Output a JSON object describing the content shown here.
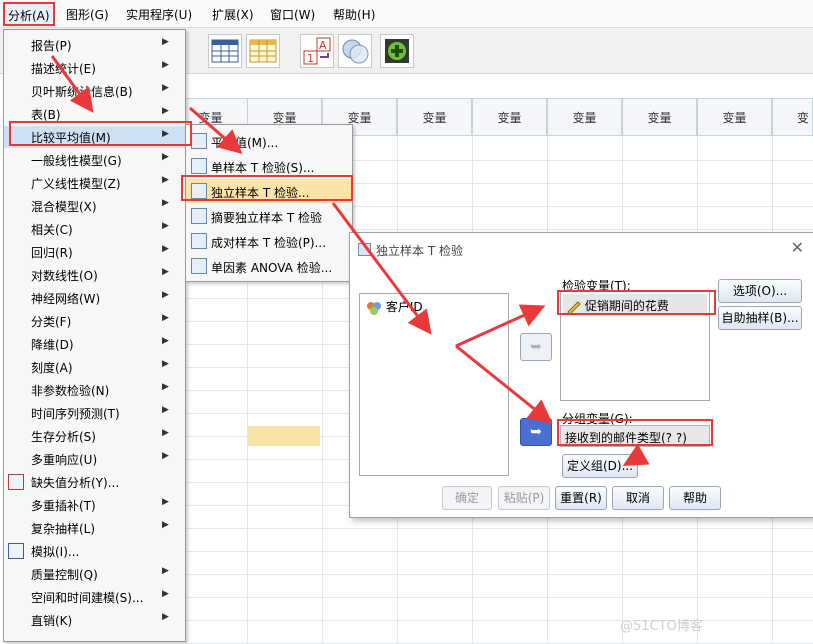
{
  "menubar": {
    "items": [
      "分析(A)",
      "图形(G)",
      "实用程序(U)",
      "扩展(X)",
      "窗口(W)",
      "帮助(H)"
    ]
  },
  "grid": {
    "column_header": "变量",
    "column_header_partial": "变"
  },
  "analyze_menu": {
    "items": [
      {
        "label": "报告(P)"
      },
      {
        "label": "描述统计(E)"
      },
      {
        "label": "贝叶斯统计信息(B)"
      },
      {
        "label": "表(B)"
      },
      {
        "label": "比较平均值(M)"
      },
      {
        "label": "一般线性模型(G)"
      },
      {
        "label": "广义线性模型(Z)"
      },
      {
        "label": "混合模型(X)"
      },
      {
        "label": "相关(C)"
      },
      {
        "label": "回归(R)"
      },
      {
        "label": "对数线性(O)"
      },
      {
        "label": "神经网络(W)"
      },
      {
        "label": "分类(F)"
      },
      {
        "label": "降维(D)"
      },
      {
        "label": "刻度(A)"
      },
      {
        "label": "非参数检验(N)"
      },
      {
        "label": "时间序列预测(T)"
      },
      {
        "label": "生存分析(S)"
      },
      {
        "label": "多重响应(U)"
      },
      {
        "label": "缺失值分析(Y)..."
      },
      {
        "label": "多重插补(T)"
      },
      {
        "label": "复杂抽样(L)"
      },
      {
        "label": "模拟(I)..."
      },
      {
        "label": "质量控制(Q)"
      },
      {
        "label": "空间和时间建模(S)..."
      },
      {
        "label": "直销(K)"
      }
    ]
  },
  "compare_means_menu": {
    "items": [
      {
        "label": "平均值(M)..."
      },
      {
        "label": "单样本 T 检验(S)..."
      },
      {
        "label": "独立样本 T 检验..."
      },
      {
        "label": "摘要独立样本 T 检验"
      },
      {
        "label": "成对样本 T 检验(P)..."
      },
      {
        "label": "单因素 ANOVA 检验..."
      }
    ]
  },
  "dialog": {
    "title": "独立样本 T 检验",
    "source_list": [
      "客户ID"
    ],
    "test_variables_label": "检验变量(T):",
    "test_variables": [
      "促销期间的花费"
    ],
    "grouping_label": "分组变量(G):",
    "grouping_value": "接收到的邮件类型(? ?)",
    "define_groups": "定义组(D)...",
    "options": "选项(O)...",
    "bootstrap": "自助抽样(B)...",
    "ok": "确定",
    "paste": "粘贴(P)",
    "reset": "重置(R)",
    "cancel": "取消",
    "help": "帮助"
  },
  "watermark": "@51CTO博客",
  "colors": {
    "annotation_red": "#e83a3a",
    "menu_highlight": "#fde3a5",
    "active_arrow": "#4d6ed1"
  }
}
